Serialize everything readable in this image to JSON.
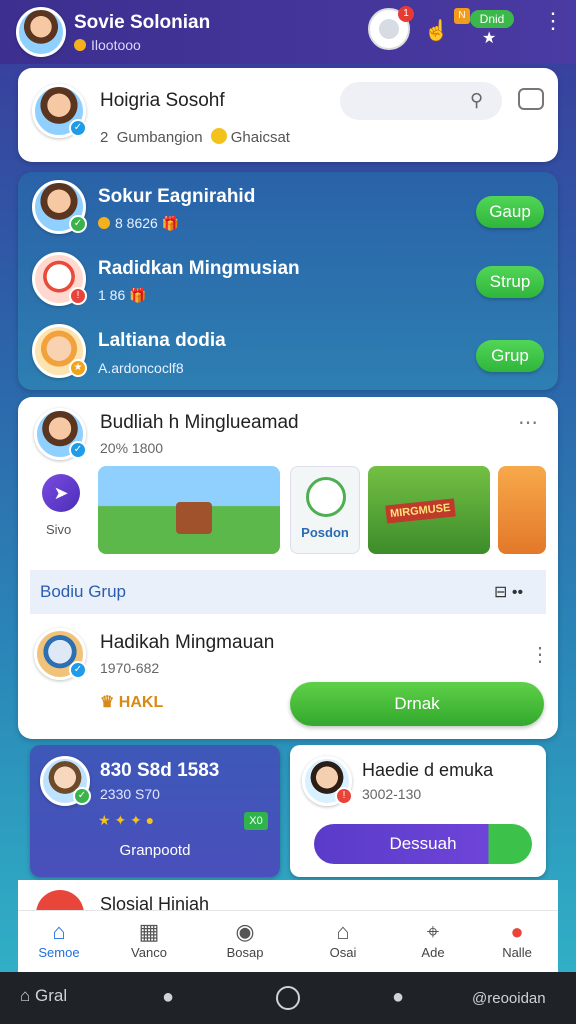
{
  "header": {
    "title": "Sovie Solonian",
    "subtitle": "Ilootooo",
    "notif_count": "1",
    "promo_label": "Dnid",
    "promo_small": "N"
  },
  "composer": {
    "name": "Hoigria Sosohf",
    "meta": "Gumbangion",
    "meta2": "Ghaicsat",
    "count": "2"
  },
  "suggested": [
    {
      "name": "Sokur Eagnirahid",
      "meta": "8 8626",
      "button": "Gaup"
    },
    {
      "name": "Radidkan Mingmusian",
      "meta": "1  86",
      "button": "Strup"
    },
    {
      "name": "Laltiana dodia",
      "meta": "A.ardoncoclf8",
      "button": "Grup"
    }
  ],
  "post": {
    "name": "Budliah h Minglueamad",
    "meta": "20% 1800",
    "side_label": "Sivo",
    "thumb_label": "Posdon",
    "thumb_banner": "MIRGMUSE"
  },
  "section": {
    "title": "Bodiu Grup"
  },
  "gift_row": {
    "name": "Hadikah Mingmauan",
    "meta": "1970-682",
    "stars_label": "HAKL",
    "button": "Drnak"
  },
  "tile_left": {
    "stats": "830 S8d 1583",
    "meta": "2330 S70",
    "chip": "X0",
    "footer": "Granpootd"
  },
  "tile_right": {
    "name": "Haedie d emuka",
    "meta": "3002-130",
    "button": "Dessuah"
  },
  "peek": {
    "title": "Slosial Hiniah"
  },
  "tabs": [
    {
      "label": "Semoe",
      "icon": "home-icon",
      "active": true
    },
    {
      "label": "Vanco",
      "icon": "store-icon",
      "active": false
    },
    {
      "label": "Bosap",
      "icon": "pin-icon",
      "active": false
    },
    {
      "label": "Osai",
      "icon": "gift-box-icon",
      "active": false
    },
    {
      "label": "Ade",
      "icon": "tag-icon",
      "active": false
    },
    {
      "label": "Nalle",
      "icon": "profile-icon",
      "active": false
    }
  ],
  "navbar": {
    "left_label": "Gral",
    "right_label": "@reooidan"
  },
  "colors": {
    "accent": "#1f6fe0",
    "green": "#33b63b",
    "purple": "#5a3bc9",
    "header": "#3c2f8f"
  }
}
